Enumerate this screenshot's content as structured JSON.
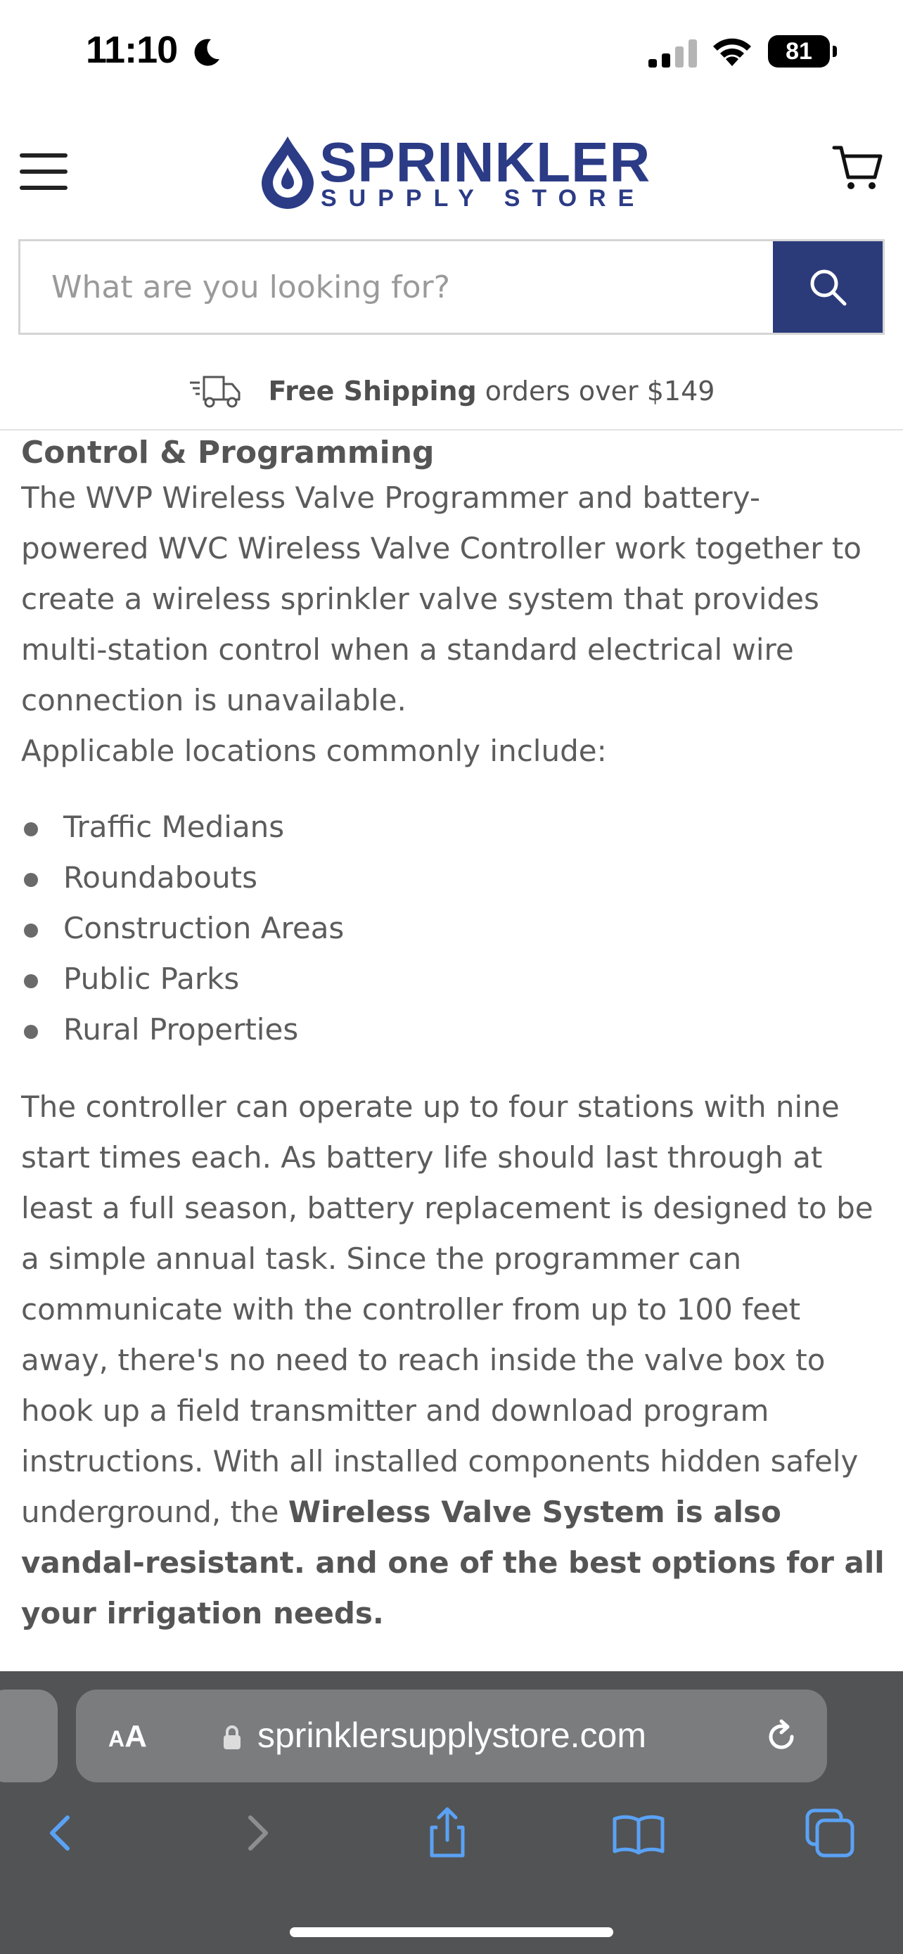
{
  "status_bar": {
    "time": "11:10",
    "battery": "81"
  },
  "header": {
    "logo_main": "SPRINKLER",
    "logo_sub": "SUPPLY STORE"
  },
  "search": {
    "placeholder": "What are you looking for?"
  },
  "shipping": {
    "bold": "Free Shipping",
    "text": "orders over $149"
  },
  "content": {
    "heading": "Control & Programming",
    "intro": "The WVP Wireless Valve Programmer and battery-powered WVC Wireless Valve Controller work together to create a wireless sprinkler valve system that provides multi-station control when a standard electrical wire connection is unavailable.",
    "locations_intro": "Applicable locations commonly include:",
    "locations": [
      "Traffic Medians",
      "Roundabouts",
      "Construction Areas",
      "Public Parks",
      "Rural Properties"
    ],
    "body": "The controller can operate up to four stations with nine start times each. As battery life should last through at least a full season, battery replacement is designed to be a simple annual task. Since the programmer can communicate with the controller from up to 100 feet away, there's no need to reach inside the valve box to hook up a field transmitter and download program instructions. With all installed components hidden safely underground, the",
    "body_bold": "Wireless Valve System is also vandal-resistant. and one of the best options for all your irrigation needs."
  },
  "safari": {
    "aa_small": "A",
    "aa_big": "A",
    "url": "sprinklersupplystore.com"
  },
  "colors": {
    "brand": "#2b3b86",
    "search_button": "#2b3b7a",
    "safari_bg": "#525355",
    "safari_blue": "#5aa2f5"
  }
}
